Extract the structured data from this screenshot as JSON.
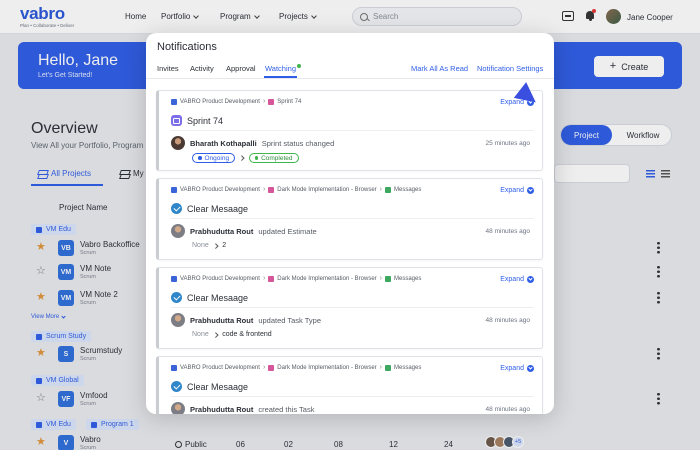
{
  "nav": {
    "logo_text": "vabro",
    "logo_tagline": "Plan • Collaborate • Deliver",
    "links": [
      {
        "label": "Home"
      },
      {
        "label": "Portfolio"
      },
      {
        "label": "Program"
      },
      {
        "label": "Projects"
      }
    ],
    "search_placeholder": "Search",
    "user_name": "Jane Cooper"
  },
  "hero": {
    "title": "Hello, Jane",
    "subtitle": "Let's Get Started!",
    "create_label": "Create"
  },
  "overview": {
    "title": "Overview",
    "subtitle": "View All your Portfolio, Program",
    "tabs": [
      {
        "label": "All Projects"
      },
      {
        "label": "My"
      }
    ],
    "column_name": "Project Name",
    "toggle": {
      "project": "Project",
      "workflow": "Workflow"
    },
    "view_more": "View More",
    "groups": {
      "vm_edu": "VM Edu",
      "scrum_study": "Scrum Study",
      "vm_global": "VM Global",
      "program_1": "Program 1"
    },
    "projects": [
      {
        "badge": "VB",
        "name": "Vabro Backoffice",
        "type": "Scrum",
        "starred": true
      },
      {
        "badge": "VM",
        "name": "VM Note",
        "type": "Scrum",
        "starred": false
      },
      {
        "badge": "VM",
        "name": "VM Note 2",
        "type": "Scrum",
        "starred": true
      },
      {
        "badge": "S",
        "name": "Scrumstudy",
        "type": "Scrum",
        "starred": true
      },
      {
        "badge": "VF",
        "name": "Vmfood",
        "type": "Scrum",
        "starred": false
      },
      {
        "badge": "V",
        "name": "Vabro",
        "type": "Scrum",
        "starred": true
      }
    ],
    "last_row": {
      "visibility": "Public",
      "c1": "06",
      "c2": "02",
      "c3": "08",
      "c4": "12",
      "c5": "24",
      "extra_members": "+5"
    }
  },
  "notifications": {
    "title": "Notifications",
    "tabs": [
      {
        "label": "Invites"
      },
      {
        "label": "Activity"
      },
      {
        "label": "Approval"
      },
      {
        "label": "Watching"
      }
    ],
    "mark_all_read": "Mark All As Read",
    "settings": "Notification Settings",
    "items": [
      {
        "crumbs": [
          "VABRO Product Development",
          "Sprint 74"
        ],
        "expand": "Expand",
        "title": "Sprint 74",
        "actor": "Bharath Kothapalli",
        "action": "Sprint status changed",
        "time": "25 minutes ago",
        "from": "Ongoing",
        "to": "Completed"
      },
      {
        "crumbs": [
          "VABRO Product Development",
          "Dark Mode Implementation - Browser",
          "Messages"
        ],
        "expand": "Expand",
        "title": "Clear Mesaage",
        "actor": "Prabhudutta Rout",
        "action": "updated Estimate",
        "time": "48 minutes ago",
        "from": "None",
        "to": "2"
      },
      {
        "crumbs": [
          "VABRO Product Development",
          "Dark Mode Implementation - Browser",
          "Messages"
        ],
        "expand": "Expand",
        "title": "Clear Mesaage",
        "actor": "Prabhudutta Rout",
        "action": "updated Task Type",
        "time": "48 minutes ago",
        "from": "None",
        "to": "code & frontend"
      },
      {
        "crumbs": [
          "VABRO Product Development",
          "Dark Mode Implementation - Browser",
          "Messages"
        ],
        "expand": "Expand",
        "title": "Clear Mesaage",
        "actor": "Prabhudutta Rout",
        "action": "created this Task",
        "time": "48 minutes ago"
      }
    ]
  },
  "colors": {
    "primary": "#2f5ee6",
    "green": "#3fb54a",
    "star": "#e0953a"
  }
}
